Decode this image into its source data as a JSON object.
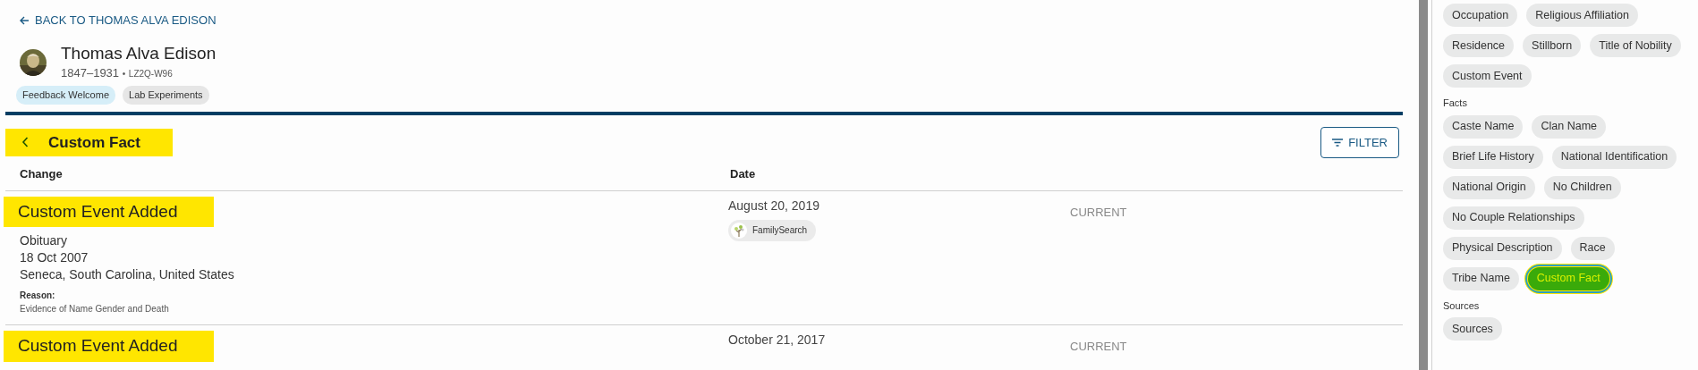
{
  "back_link": "BACK TO THOMAS ALVA EDISON",
  "person": {
    "name": "Thomas Alva Edison",
    "lifespan": "1847–1931",
    "separator": "•",
    "id": "LZ2Q-W96",
    "tags": [
      {
        "label": "Feedback Welcome",
        "color": "#d6eef8"
      },
      {
        "label": "Lab Experiments",
        "color": "#e6e6e6"
      }
    ]
  },
  "section": {
    "title": "Custom Fact",
    "highlighted": true
  },
  "filter_button": "FILTER",
  "table": {
    "columns": [
      "Change",
      "Date"
    ],
    "rows": [
      {
        "title": "Custom Event Added",
        "highlighted": true,
        "details": [
          "Obituary",
          "18 Oct 2007",
          "Seneca, South Carolina, United States"
        ],
        "reason_label": "Reason:",
        "reason": "Evidence of Name Gender and Death",
        "date": "August 20, 2019",
        "contributor": "FamilySearch",
        "status": "CURRENT"
      },
      {
        "title": "Custom Event Added",
        "highlighted": true,
        "date": "October 21, 2017",
        "status": "CURRENT"
      }
    ]
  },
  "sidebar": {
    "groups": [
      {
        "chips": [
          {
            "label": "Occupation",
            "selected": false
          },
          {
            "label": "Religious Affiliation",
            "selected": false
          },
          {
            "label": "Residence",
            "selected": false
          },
          {
            "label": "Stillborn",
            "selected": false
          },
          {
            "label": "Title of Nobility",
            "selected": false
          },
          {
            "label": "Custom Event",
            "selected": false
          }
        ]
      },
      {
        "label": "Facts",
        "chips": [
          {
            "label": "Caste Name",
            "selected": false
          },
          {
            "label": "Clan Name",
            "selected": false
          },
          {
            "label": "Brief Life History",
            "selected": false
          },
          {
            "label": "National Identification",
            "selected": false
          },
          {
            "label": "National Origin",
            "selected": false
          },
          {
            "label": "No Children",
            "selected": false
          },
          {
            "label": "No Couple Relationships",
            "selected": false
          },
          {
            "label": "Physical Description",
            "selected": false
          },
          {
            "label": "Race",
            "selected": false
          },
          {
            "label": "Tribe Name",
            "selected": false
          },
          {
            "label": "Custom Fact",
            "selected": true,
            "highlighted": true
          }
        ]
      },
      {
        "label": "Sources",
        "chips": [
          {
            "label": "Sources",
            "selected": false
          }
        ]
      }
    ]
  }
}
